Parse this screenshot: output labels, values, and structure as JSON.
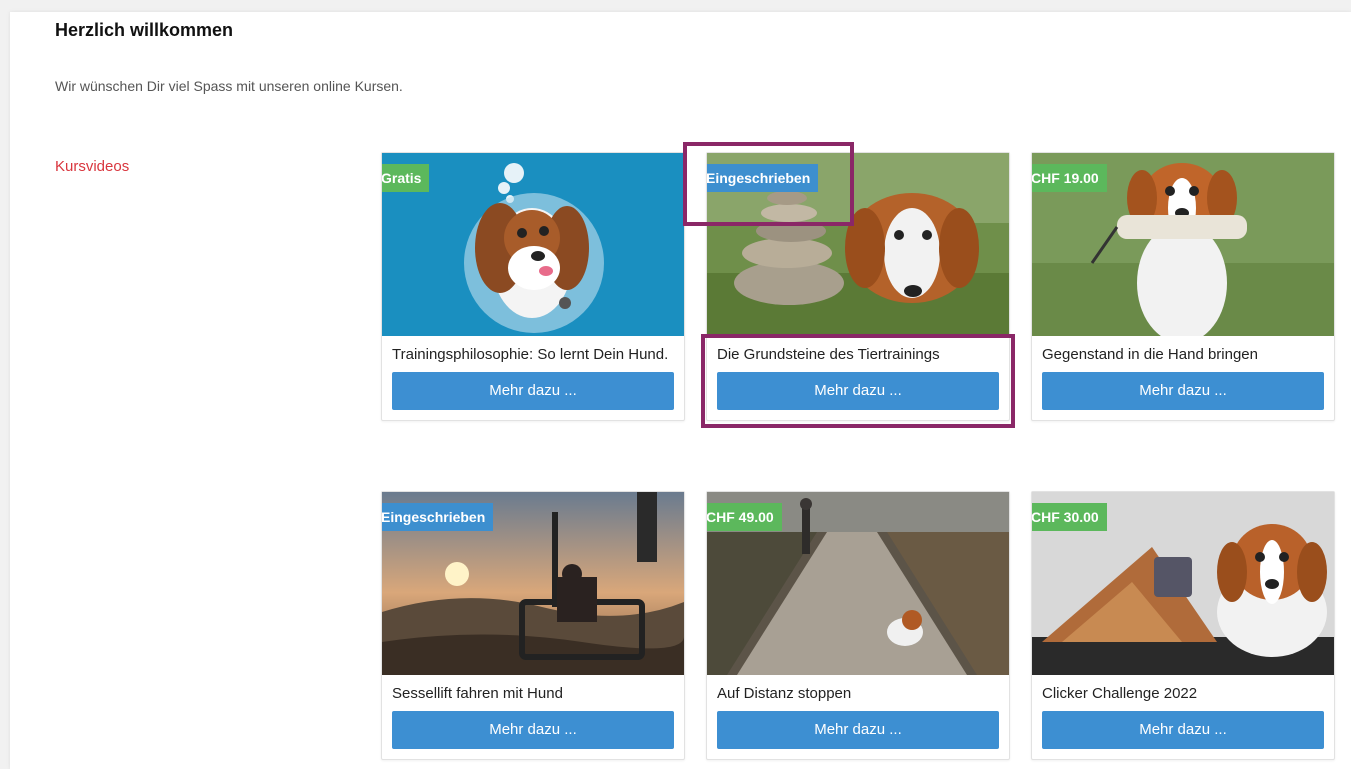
{
  "page": {
    "title": "Herzlich willkommen",
    "subtitle": "Wir wünschen Dir viel Spass mit unseren online Kursen.",
    "category_link": "Kursvideos"
  },
  "colors": {
    "accent_red": "#d9363e",
    "button_blue": "#3d8fd2",
    "badge_green": "#5cb85c",
    "badge_blue": "#3d8fcf",
    "highlight_purple": "#8a2767"
  },
  "courses": [
    {
      "title": "Trainingsphilosophie: So lernt Dein Hund.",
      "badge": "Gratis",
      "badge_color": "green",
      "button": "Mehr dazu ...",
      "image": "cartoon-dog-illustration"
    },
    {
      "title": "Die Grundsteine des Tiertrainings",
      "badge": "Eingeschrieben",
      "badge_color": "blue",
      "button": "Mehr dazu ...",
      "image": "dog-with-stacked-stones-photo"
    },
    {
      "title": "Gegenstand in die Hand bringen",
      "badge": "CHF 19.00",
      "badge_color": "green",
      "button": "Mehr dazu ...",
      "image": "dog-carrying-dummy-photo"
    },
    {
      "title": "Sessellift fahren mit Hund",
      "badge": "Eingeschrieben",
      "badge_color": "blue",
      "button": "Mehr dazu ...",
      "image": "chairlift-sunset-photo"
    },
    {
      "title": "Auf Distanz stoppen",
      "badge": "CHF 49.00",
      "badge_color": "green",
      "button": "Mehr dazu ...",
      "image": "dog-on-forest-path-photo"
    },
    {
      "title": "Clicker Challenge 2022",
      "badge": "CHF 30.00",
      "badge_color": "green",
      "button": "Mehr dazu ...",
      "image": "dog-with-clicker-photo"
    }
  ]
}
